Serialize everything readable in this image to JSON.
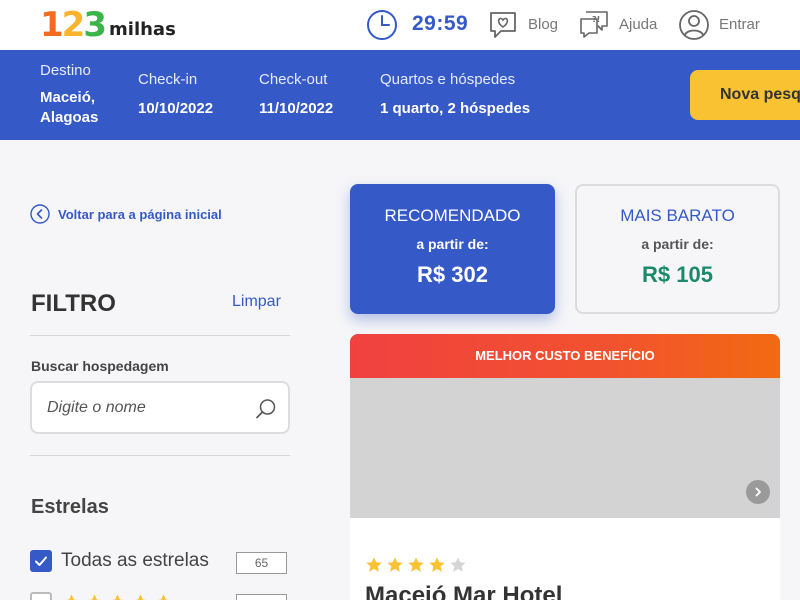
{
  "header": {
    "logo_digits": [
      "1",
      "2",
      "3"
    ],
    "logo_word": "milhas",
    "timer": "29:59",
    "blog_label": "Blog",
    "help_label": "Ajuda",
    "login_label": "Entrar"
  },
  "search_summary": {
    "destination_label": "Destino",
    "destination_value": "Maceió, Alagoas",
    "checkin_label": "Check-in",
    "checkin_value": "10/10/2022",
    "checkout_label": "Check-out",
    "checkout_value": "11/10/2022",
    "guests_label": "Quartos e hóspedes",
    "guests_value": "1 quarto, 2 hóspedes",
    "new_search_label": "Nova pesquisa"
  },
  "sidebar": {
    "back_label": "Voltar para a página inicial",
    "filter_title": "FILTRO",
    "clear_label": "Limpar",
    "search_label": "Buscar hospedagem",
    "search_placeholder": "Digite o nome",
    "stars_title": "Estrelas",
    "stars_options": [
      {
        "label": "Todas as estrelas",
        "count": "65",
        "checked": true
      },
      {
        "label": "",
        "stars": 5,
        "checked": false
      }
    ]
  },
  "price_cards": {
    "recommended": {
      "title": "RECOMENDADO",
      "subtitle": "a partir de:",
      "price": "R$ 302"
    },
    "cheapest": {
      "title": "MAIS BARATO",
      "subtitle": "a partir de:",
      "price": "R$ 105"
    }
  },
  "hotel": {
    "banner": "MELHOR CUSTO BENEFÍCIO",
    "name": "Maceió Mar Hotel",
    "stars": 4,
    "max_stars": 5
  },
  "colors": {
    "brand_blue": "#3559c7",
    "accent_yellow": "#f8c233",
    "price_green": "#1a8a6a",
    "star_gold": "#f8c233"
  }
}
